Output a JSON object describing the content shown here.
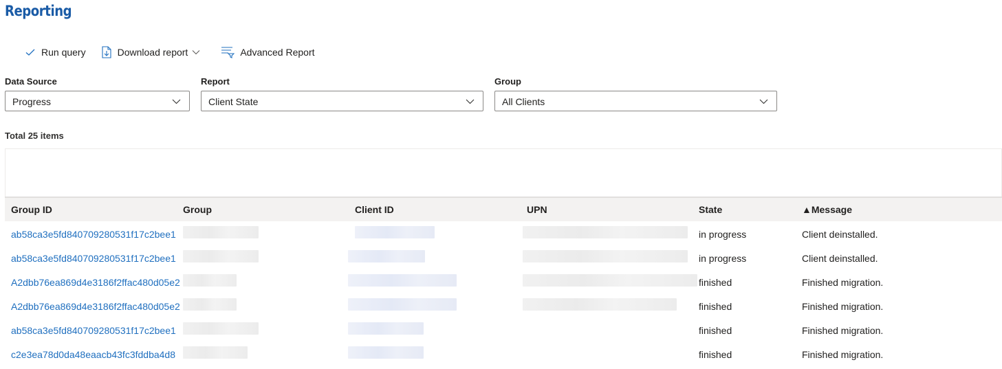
{
  "page": {
    "title": "Reporting"
  },
  "toolbar": {
    "run_query": "Run query",
    "download_report": "Download report",
    "advanced_report": "Advanced Report"
  },
  "filters": {
    "data_source": {
      "label": "Data Source",
      "value": "Progress"
    },
    "report": {
      "label": "Report",
      "value": "Client State"
    },
    "group": {
      "label": "Group",
      "value": "All Clients"
    }
  },
  "summary": {
    "total": "Total 25 items"
  },
  "table": {
    "columns": {
      "group_id": "Group ID",
      "group": "Group",
      "client_id": "Client ID",
      "upn": "UPN",
      "state": "State",
      "message": "▲Message"
    },
    "rows": [
      {
        "group_id": "ab58ca3e5fd840709280531f17c2bee1",
        "state": "in progress",
        "message": "Client deinstalled."
      },
      {
        "group_id": "ab58ca3e5fd840709280531f17c2bee1",
        "state": "in progress",
        "message": "Client deinstalled."
      },
      {
        "group_id": "A2dbb76ea869d4e3186f2ffac480d05e2",
        "state": "finished",
        "message": "Finished migration."
      },
      {
        "group_id": "A2dbb76ea869d4e3186f2ffac480d05e2",
        "state": "finished",
        "message": "Finished migration."
      },
      {
        "group_id": "ab58ca3e5fd840709280531f17c2bee1",
        "state": "finished",
        "message": "Finished migration."
      },
      {
        "group_id": "c2e3ea78d0da48eaacb43fc3fddba4d8",
        "state": "finished",
        "message": "Finished migration."
      }
    ]
  },
  "colors": {
    "accent": "#1a5ba6",
    "link": "#1f6fbf",
    "header_bg": "#f3f2f1"
  }
}
